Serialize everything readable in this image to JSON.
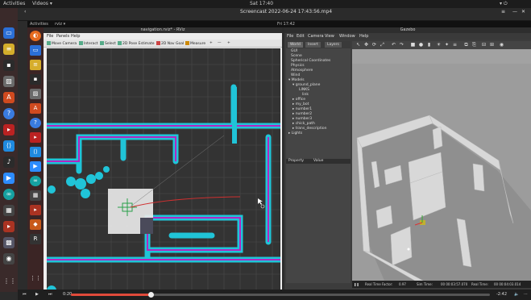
{
  "outer": {
    "activities": "Activities",
    "app_menu": "Videos ▾",
    "clock": "Sat 17:40",
    "video_title": "Screencast 2022-06-24 17:43:56.mp4"
  },
  "inner": {
    "activities": "Activities",
    "app_menu": "rviz ▾",
    "clock": "Fri 17:42"
  },
  "rviz": {
    "title": "navigation.rviz* - RViz",
    "menu": [
      "File",
      "Panels",
      "Help"
    ],
    "tools": [
      "Move Camera",
      "Interact",
      "Select",
      "2D Pose Estimate",
      "2D Nav Goal",
      "Measure",
      "+",
      "—",
      "+"
    ]
  },
  "gazebo": {
    "title": "Gazebo",
    "menu": [
      "File",
      "Edit",
      "Camera",
      "View",
      "Window",
      "Help"
    ],
    "tabs": [
      "World",
      "Insert",
      "Layers"
    ],
    "tree": [
      "GUI",
      "Scene",
      "Spherical Coordinates",
      "Physics",
      "Atmosphere",
      "Wind",
      "▾ Models",
      "▾ ground_plane",
      "LINKS",
      "link",
      "▸ office",
      "▸ my_bot",
      "▸ number1",
      "▸ number2",
      "▸ number3",
      "▸ chick_path",
      "▸ trans_description",
      "▸ Lights"
    ],
    "prop_headers": [
      "Property",
      "Value"
    ],
    "status": {
      "real_time_factor_label": "Real Time Factor:",
      "real_time_factor": "0.97",
      "sim_time_label": "Sim Time:",
      "sim_time": "00 00:03:57.070",
      "real_time_label": "Real Time:",
      "real_time": "00 00:04:03.014"
    }
  },
  "player": {
    "elapsed": "0:20",
    "remaining": "-2:42",
    "progress": 0.19
  }
}
